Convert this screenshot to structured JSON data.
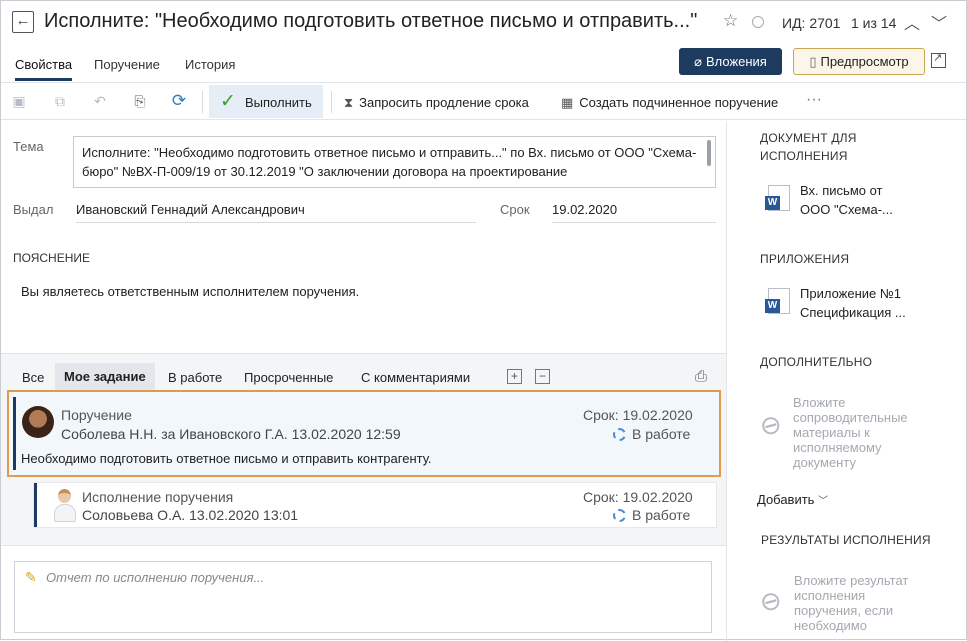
{
  "window": {
    "title": "Исполните: \"Необходимо подготовить ответное письмо и отправить...\"",
    "id_label": "ИД: 2701",
    "pager": "1 из 14"
  },
  "tabs": [
    "Свойства",
    "Поручение",
    "История"
  ],
  "header_buttons": {
    "attachments": "Вложения",
    "preview": "Предпросмотр"
  },
  "toolbar": {
    "execute": "Выполнить",
    "request_extension": "Запросить продление срока",
    "create_subtask": "Создать подчиненное поручение",
    "more": "···"
  },
  "form": {
    "tema_label": "Тема",
    "tema_value": "Исполните: \"Необходимо подготовить ответное письмо и отправить...\" по Вх. письмо от ООО \"Схема-бюро\" №ВХ-П-009/19 от 30.12.2019 \"О заключении договора на проектирование",
    "vydal_label": "Выдал",
    "vydal_value": "Ивановский Геннадий Александрович",
    "srok_label": "Срок",
    "srok_value": "19.02.2020",
    "explanation_label": "ПОЯСНЕНИЕ",
    "explanation_value": "Вы являетесь ответственным исполнителем поручения."
  },
  "task_filters": [
    "Все",
    "Мое задание",
    "В работе",
    "Просроченные",
    "С комментариями"
  ],
  "tasks": [
    {
      "title": "Поручение",
      "who": "Соболева Н.Н. за Ивановского Г.А.  13.02.2020 12:59",
      "due": "Срок: 19.02.2020",
      "status": "В работе",
      "text": "Необходимо подготовить ответное письмо и отправить контрагенту."
    },
    {
      "title": "Исполнение поручения",
      "who": "Соловьева О.А.  13.02.2020 13:01",
      "due": "Срок: 19.02.2020",
      "status": "В работе"
    }
  ],
  "report_placeholder": "Отчет по исполнению поручения...",
  "right_panel": {
    "doc_section": "ДОКУМЕНТ ДЛЯ ИСПОЛНЕНИЯ",
    "doc_name": "Вх. письмо от ООО \"Схема-...",
    "attachments_section": "ПРИЛОЖЕНИЯ",
    "attachment_name": "Приложение №1 Спецификация ...",
    "extra_section": "ДОПОЛНИТЕЛЬНО",
    "extra_hint": "Вложите сопроводительные материалы к исполняемому документу",
    "add_label": "Добавить",
    "results_section": "РЕЗУЛЬТАТЫ ИСПОЛНЕНИЯ",
    "results_hint": "Вложите результат исполнения поручения, если необходимо"
  },
  "icons": {
    "accent": "#1d3a5f",
    "highlight_border": "#e09a4e",
    "success": "#3f9b2e"
  }
}
